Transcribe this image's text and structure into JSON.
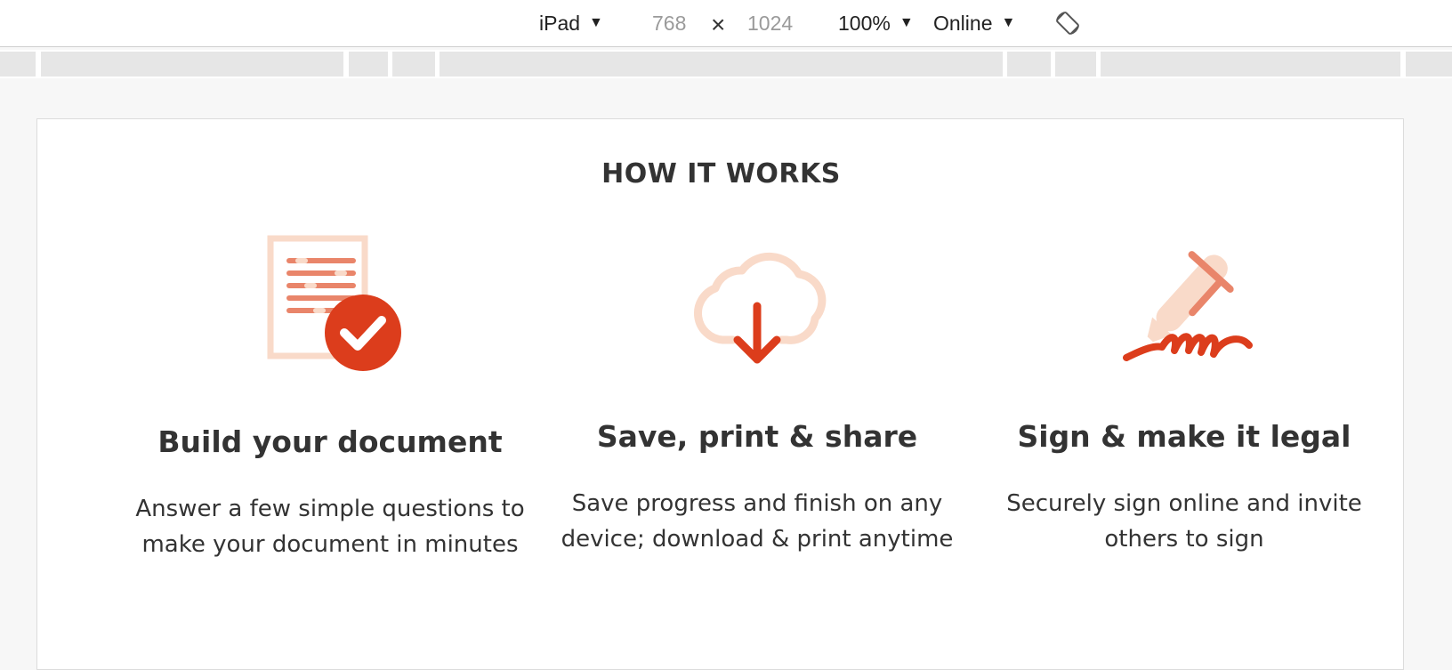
{
  "toolbar": {
    "device_label": "iPad",
    "width_value": "768",
    "times_symbol": "×",
    "height_value": "1024",
    "zoom_label": "100%",
    "network_label": "Online",
    "caret_icon": "triangle-down-icon",
    "rotate_icon": "rotate-device-icon"
  },
  "page": {
    "section_title": "HOW IT WORKS",
    "steps": [
      {
        "icon": "document-check-icon",
        "title": "Build your document",
        "description_line1": "Answer a few simple questions to",
        "description_line2": "make your document in minutes"
      },
      {
        "icon": "cloud-download-icon",
        "title": "Save, print & share",
        "description_line1": "Save progress and finish on any",
        "description_line2": "device; download & print anytime"
      },
      {
        "icon": "pen-signature-icon",
        "title": "Sign & make it legal",
        "description_line1": "Securely sign online and invite",
        "description_line2": "others to sign"
      }
    ]
  },
  "colors": {
    "accent": "#dc3d1c",
    "accent_light": "#f9dac9",
    "accent_mid": "#e9856a",
    "text": "#333333"
  }
}
